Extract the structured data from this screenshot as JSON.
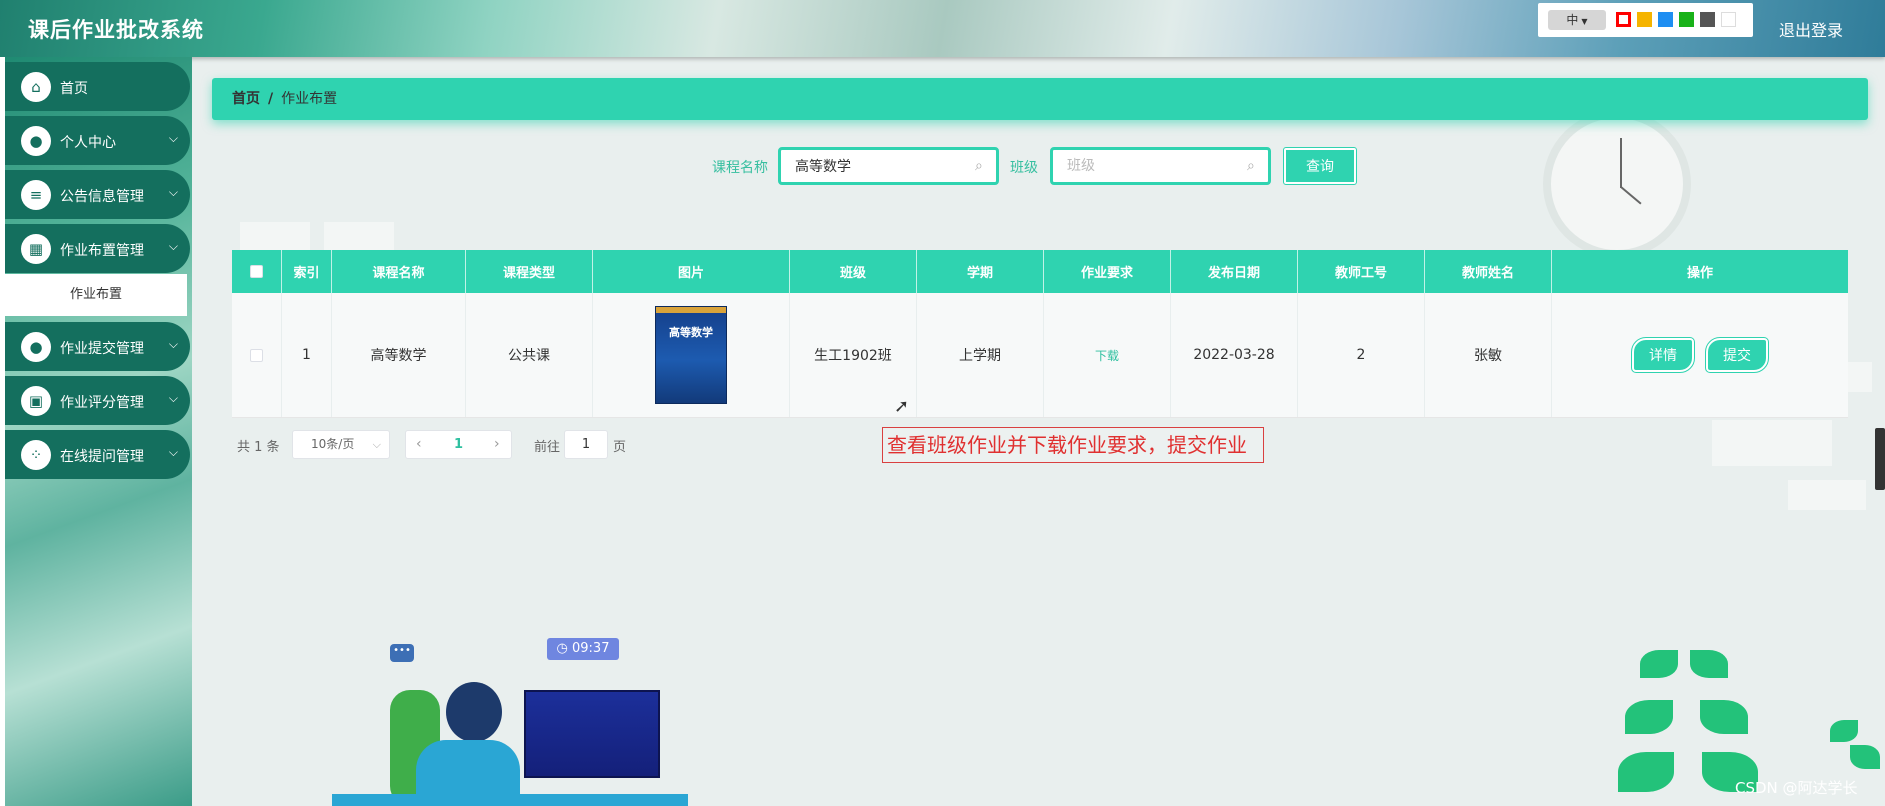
{
  "app": {
    "title": "课后作业批改系统",
    "logout_label": "退出登录",
    "lang_selected": "中",
    "theme_colors": [
      "#ff0000",
      "#f5b400",
      "#1e8ef2",
      "#19b219",
      "#555555",
      "#ffffff"
    ]
  },
  "sidebar": {
    "items": [
      {
        "label": "首页",
        "icon": "home-icon",
        "glyph": "⌂"
      },
      {
        "label": "个人中心",
        "icon": "user-icon",
        "glyph": "●"
      },
      {
        "label": "公告信息管理",
        "icon": "list-icon",
        "glyph": "≡"
      },
      {
        "label": "作业布置管理",
        "icon": "grid-icon",
        "glyph": "▦"
      },
      {
        "label": "作业提交管理",
        "icon": "user-icon",
        "glyph": "●"
      },
      {
        "label": "作业评分管理",
        "icon": "chart-icon",
        "glyph": "▣"
      },
      {
        "label": "在线提问管理",
        "icon": "apps-icon",
        "glyph": "⁘"
      }
    ],
    "sub_item": "作业布置"
  },
  "breadcrumb": {
    "home": "首页",
    "sep": "/",
    "current": "作业布置"
  },
  "search": {
    "course_label": "课程名称",
    "course_value": "高等数学",
    "class_label": "班级",
    "class_placeholder": "班级",
    "query_label": "查询"
  },
  "table": {
    "headers": [
      "索引",
      "课程名称",
      "课程类型",
      "图片",
      "班级",
      "学期",
      "作业要求",
      "发布日期",
      "教师工号",
      "教师姓名",
      "操作"
    ],
    "row": {
      "index": "1",
      "course": "高等数学",
      "course_type": "公共课",
      "book_title": "高等数学",
      "class": "生工1902班",
      "term": "上学期",
      "requirement": "下载",
      "date": "2022-03-28",
      "teacher_id": "2",
      "teacher_name": "张敏",
      "detail_label": "详情",
      "submit_label": "提交"
    }
  },
  "pagination": {
    "total": "共 1 条",
    "page_size": "10条/页",
    "current_page": "1",
    "goto_label": "前往",
    "goto_value": "1",
    "page_unit": "页"
  },
  "annotation": "查看班级作业并下载作业要求，提交作业",
  "illustration": {
    "time": "09:37"
  },
  "watermark": "CSDN @阿达学长"
}
